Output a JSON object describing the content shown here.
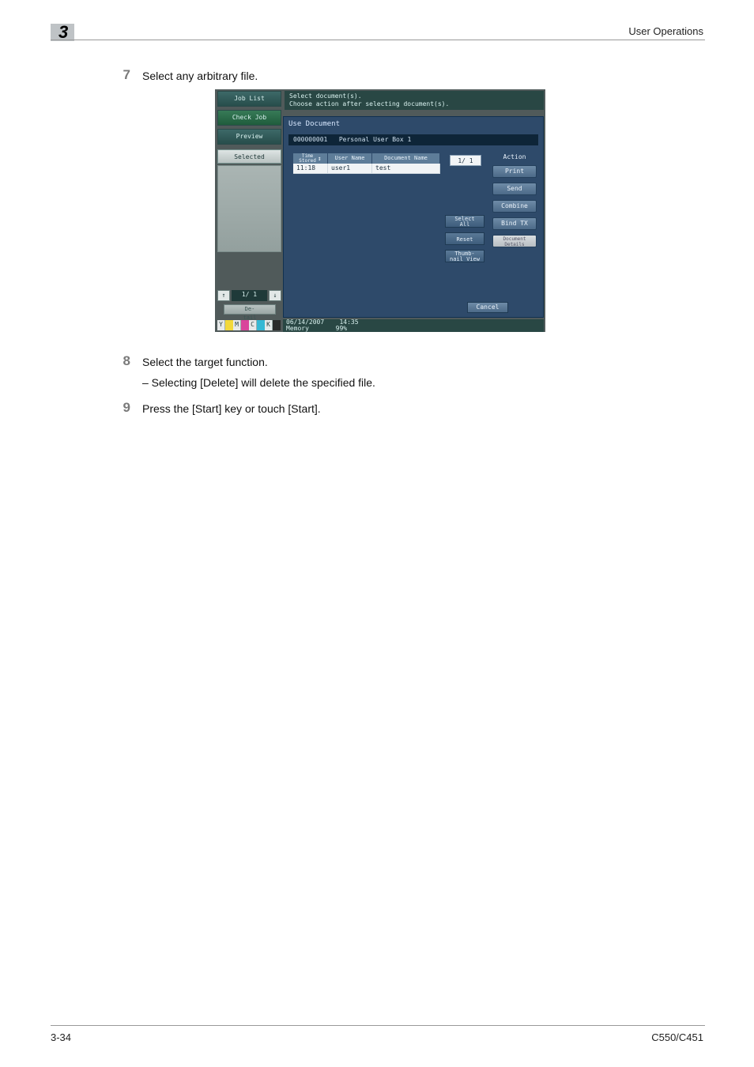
{
  "header": {
    "section_title": "User Operations",
    "chapter_number": "3"
  },
  "footer": {
    "page_number": "3-34",
    "model": "C550/C451"
  },
  "steps": {
    "s7": {
      "num": "7",
      "text": "Select any arbitrary file."
    },
    "s8": {
      "num": "8",
      "text": "Select the target function.",
      "sub": "–   Selecting [Delete] will delete the specified file."
    },
    "s9": {
      "num": "9",
      "text": "Press the [Start] key or touch [Start]."
    }
  },
  "screenshot": {
    "sidebar": {
      "job_list": "Job List",
      "check_job": "Check Job",
      "preview": "Preview",
      "selected_docs": "Selected Documents",
      "pager": {
        "up": "↑",
        "down": "↓",
        "indicator": "1/  1"
      },
      "detail": "De-\ntail",
      "toner": {
        "y": "Y",
        "m": "M",
        "c": "C",
        "k": "K"
      }
    },
    "info": {
      "line1": "Select document(s).",
      "line2": "Choose action after selecting document(s)."
    },
    "main": {
      "title": "Use Document",
      "crumb_id": "000000001",
      "crumb_name": "Personal User Box 1",
      "table": {
        "head_time": "Time\nStored",
        "head_sort": "↕",
        "head_user": "User Name",
        "head_doc": "Document Name",
        "row1_time": "11:18",
        "row1_user": "user1",
        "row1_doc": "test"
      },
      "page_indicator": "1/  1",
      "util": {
        "select_all": "Select\nAll",
        "reset": "Reset",
        "thumb": "Thumb-\nnail View"
      },
      "action": {
        "label": "Action",
        "print": "Print",
        "send": "Send",
        "combine": "Combine",
        "bind": "Bind TX",
        "details": "Document\nDetails"
      },
      "cancel": "Cancel"
    },
    "status": {
      "date": "06/14/2007",
      "time": "14:35",
      "memory_label": "Memory",
      "memory_value": "99%"
    }
  }
}
